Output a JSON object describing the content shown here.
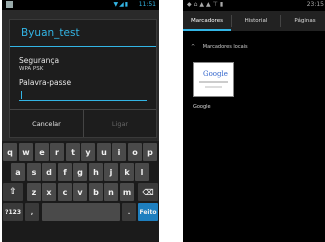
{
  "left": {
    "status_time": "11:51",
    "dialog": {
      "title": "Byuan_test",
      "security_label": "Segurança",
      "security_value": "WPA PSK",
      "password_label": "Palavra-passe",
      "cancel_label": "Cancelar",
      "connect_label": "Ligar"
    },
    "keyboard": {
      "row1": [
        "q",
        "w",
        "e",
        "r",
        "t",
        "y",
        "u",
        "i",
        "o",
        "p"
      ],
      "row2": [
        "a",
        "s",
        "d",
        "f",
        "g",
        "h",
        "j",
        "k",
        "l"
      ],
      "row3": [
        "z",
        "x",
        "c",
        "v",
        "b",
        "n",
        "m"
      ],
      "shift_glyph": "⇧",
      "backspace_glyph": "⌫",
      "symbols_label": "?123",
      "comma_label": ",",
      "period_label": ".",
      "done_label": "Feito"
    }
  },
  "right": {
    "status_time": "23:15",
    "tabs": [
      "Marcadores",
      "Historial",
      "Páginas"
    ],
    "section_title": "Marcadores locais",
    "bookmark": {
      "thumb_logo": "Google",
      "label": "Google"
    }
  }
}
